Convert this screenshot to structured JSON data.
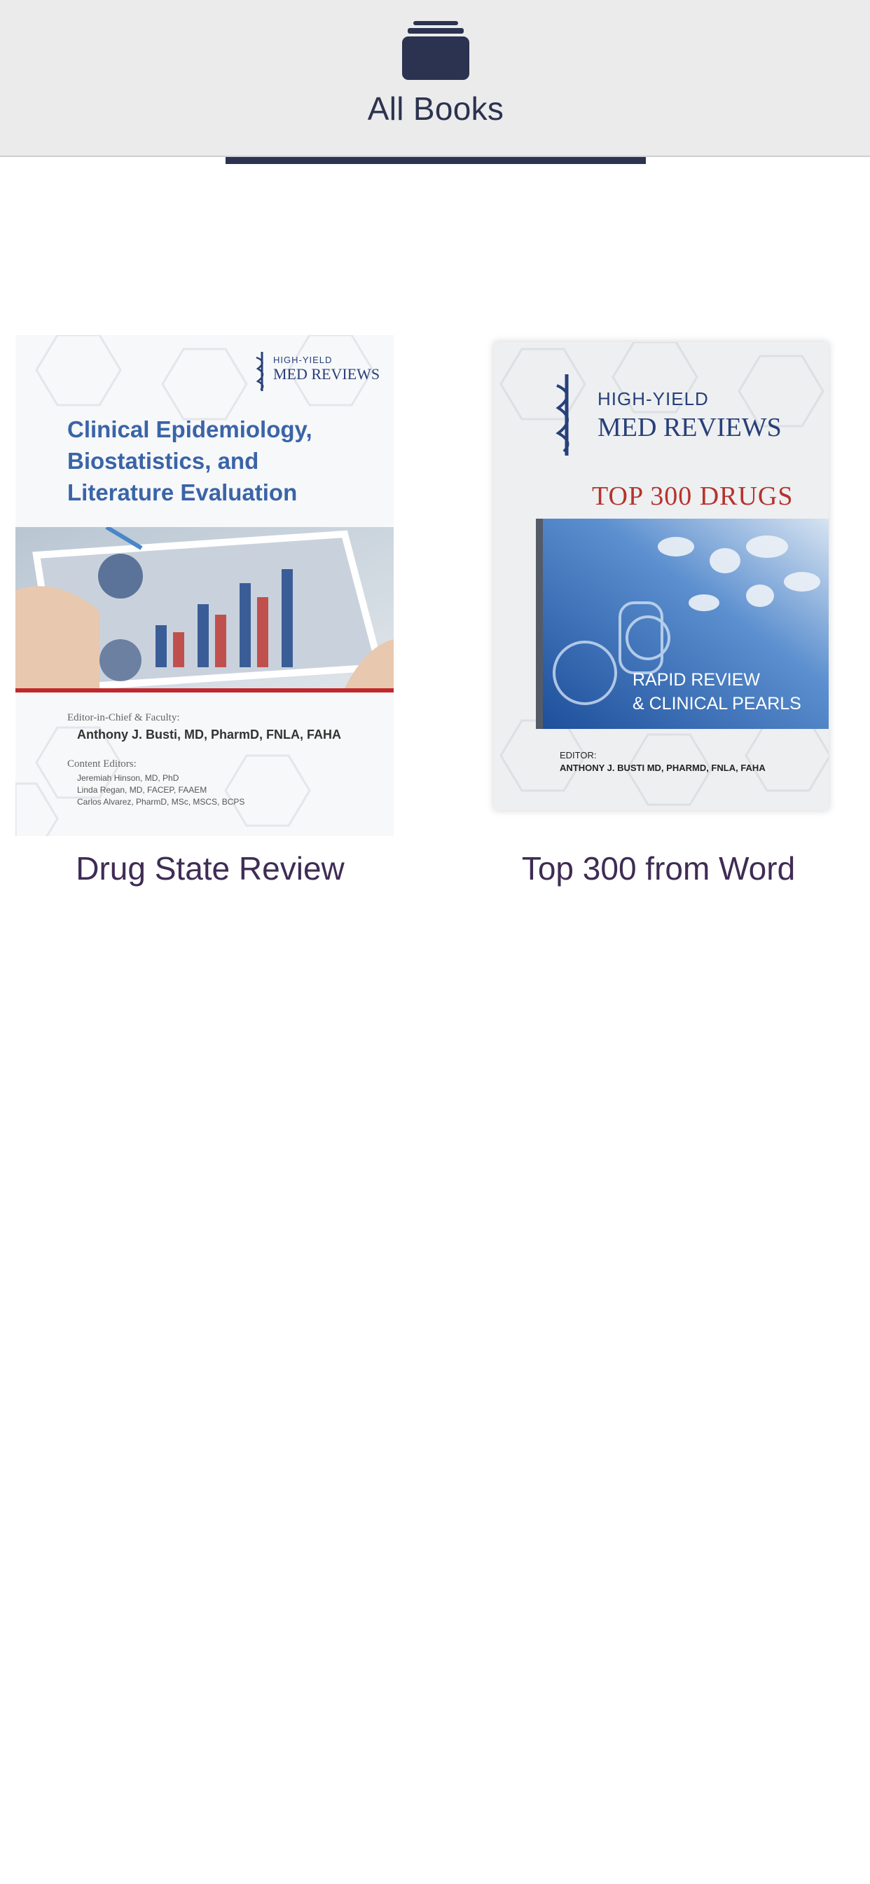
{
  "header": {
    "tab_label": "All Books",
    "tab_icon": "archive-box-icon",
    "accent_color": "#2b3350"
  },
  "books": [
    {
      "title": "Drug State Review",
      "cover": {
        "brand_small": "HIGH-YIELD",
        "brand_big": "MED REVIEWS",
        "title_lines": [
          "Clinical Epidemiology,",
          "Biostatistics, and",
          "Literature Evaluation"
        ],
        "editor_label": "Editor-in-Chief & Faculty:",
        "editor_name": "Anthony J. Busti, MD, PharmD, FNLA, FAHA",
        "content_editors_label": "Content Editors:",
        "content_editors": [
          "Jeremiah Hinson, MD, PhD",
          "Linda Regan, MD, FACEP, FAAEM",
          "Carlos Alvarez, PharmD, MSc, MSCS, BCPS"
        ]
      }
    },
    {
      "title": "Top 300 from Word",
      "cover": {
        "brand_small": "HIGH-YIELD",
        "brand_big": "MED REVIEWS",
        "headline": "TOP 300 DRUGS",
        "tagline_1": "RAPID REVIEW",
        "tagline_2": "& CLINICAL PEARLS",
        "editor_label": "EDITOR:",
        "editor_name": "ANTHONY J. BUSTI MD, PHARMD, FNLA, FAHA"
      }
    }
  ]
}
